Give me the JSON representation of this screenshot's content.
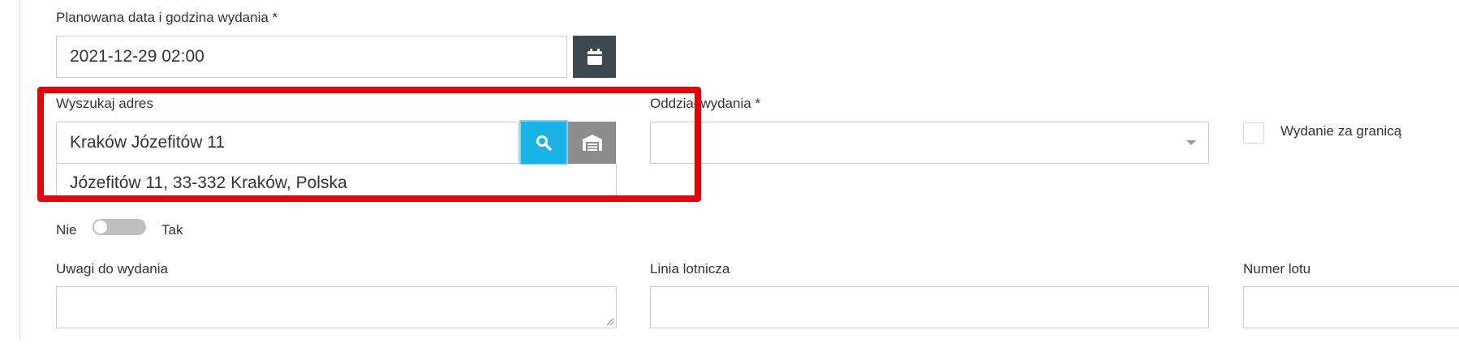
{
  "date_field": {
    "label": "Planowana data i godzina wydania *",
    "value": "2021-12-29 02:00",
    "icon": "calendar-icon"
  },
  "address_search": {
    "label": "Wyszukaj adres",
    "value": "Kraków Józefitów 11",
    "search_icon": "search-icon",
    "warehouse_icon": "warehouse-icon",
    "suggestion": "Józefitów 11, 33-332 Kraków, Polska"
  },
  "branch_field": {
    "label": "Oddział wydania *",
    "value": ""
  },
  "abroad_checkbox": {
    "label": "Wydanie za granicą",
    "checked": false
  },
  "toggle": {
    "off_label": "Nie",
    "on_label": "Tak",
    "state": false
  },
  "remarks_field": {
    "label": "Uwagi do wydania",
    "value": ""
  },
  "airline_field": {
    "label": "Linia lotnicza",
    "value": ""
  },
  "flight_field": {
    "label": "Numer lotu",
    "value": ""
  },
  "colors": {
    "accent": "#19b3e6",
    "dark_button": "#3d4a4f",
    "grey_button": "#8d8d8d",
    "highlight": "#e8000b"
  }
}
